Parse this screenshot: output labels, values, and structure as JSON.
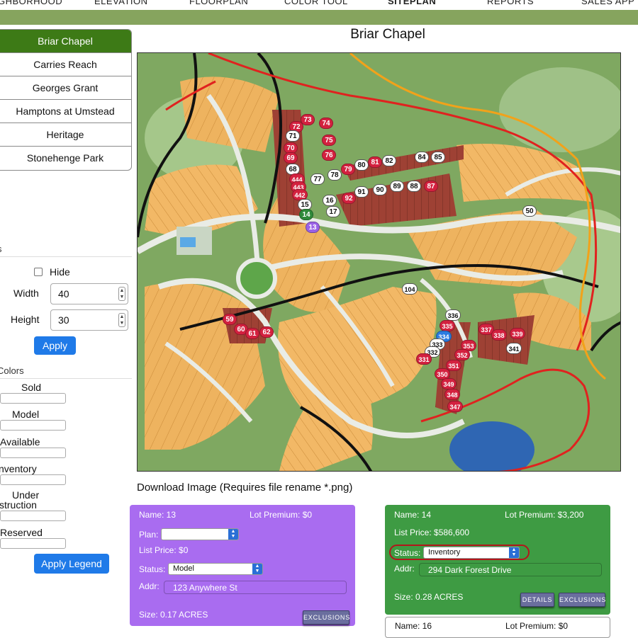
{
  "topnav": [
    "GHBORHOOD",
    "ELEVATION",
    "FLOORPLAN",
    "COLOR TOOL",
    "SITEPLAN",
    "REPORTS",
    "SALES APP"
  ],
  "communities": [
    "Briar Chapel",
    "Carries Reach",
    "Georges Grant",
    "Hamptons at Umstead",
    "Heritage",
    "Stonehenge Park"
  ],
  "lot_size_section": "s",
  "hide_label": "Hide",
  "width_label": "Width",
  "width_value": "40",
  "height_label": "Height",
  "height_value": "30",
  "apply_label": "Apply",
  "colors_section": "Colors",
  "legend": [
    "Sold",
    "Model",
    "Available",
    "nventory",
    "Under",
    "struction",
    "Reserved"
  ],
  "apply_legend_label": "Apply Legend",
  "map_title": "Briar Chapel",
  "download_text": "Download Image (Requires file rename *.png)",
  "lot_markers": [
    "73",
    "74",
    "72",
    "71",
    "75",
    "70",
    "69",
    "76",
    "68",
    "444",
    "443",
    "442",
    "15",
    "14",
    "13",
    "77",
    "78",
    "79",
    "80",
    "81",
    "82",
    "84",
    "85",
    "16",
    "17",
    "92",
    "91",
    "90",
    "89",
    "88",
    "87",
    "50",
    "104",
    "59",
    "60",
    "61",
    "62",
    "336",
    "335",
    "334",
    "333",
    "332",
    "331",
    "337",
    "338",
    "339",
    "353",
    "352",
    "351",
    "350",
    "349",
    "348",
    "347",
    "341"
  ],
  "card1": {
    "name": "Name: 13",
    "premium": "Lot Premium: $0",
    "plan_label": "Plan:",
    "list_price": "List Price: $0",
    "status_label": "Status:",
    "status_value": "Model",
    "addr_label": "Addr:",
    "addr_value": "123 Anywhere St",
    "size": "Size: 0.17 ACRES",
    "exclusions": "EXCLUSIONS",
    "color": "#a96cf0"
  },
  "card2": {
    "name": "Name: 14",
    "premium": "Lot Premium: $3,200",
    "list_price": "List Price: $586,600",
    "status_label": "Status:",
    "status_value": "Inventory",
    "addr_label": "Addr:",
    "addr_value": "294 Dark Forest Drive",
    "size": "Size: 0.28 ACRES",
    "details": "DETAILS",
    "exclusions": "EXCLUSIONS",
    "color": "#3e9b43"
  },
  "card3": {
    "name": "Name: 16",
    "premium": "Lot Premium: $0"
  }
}
